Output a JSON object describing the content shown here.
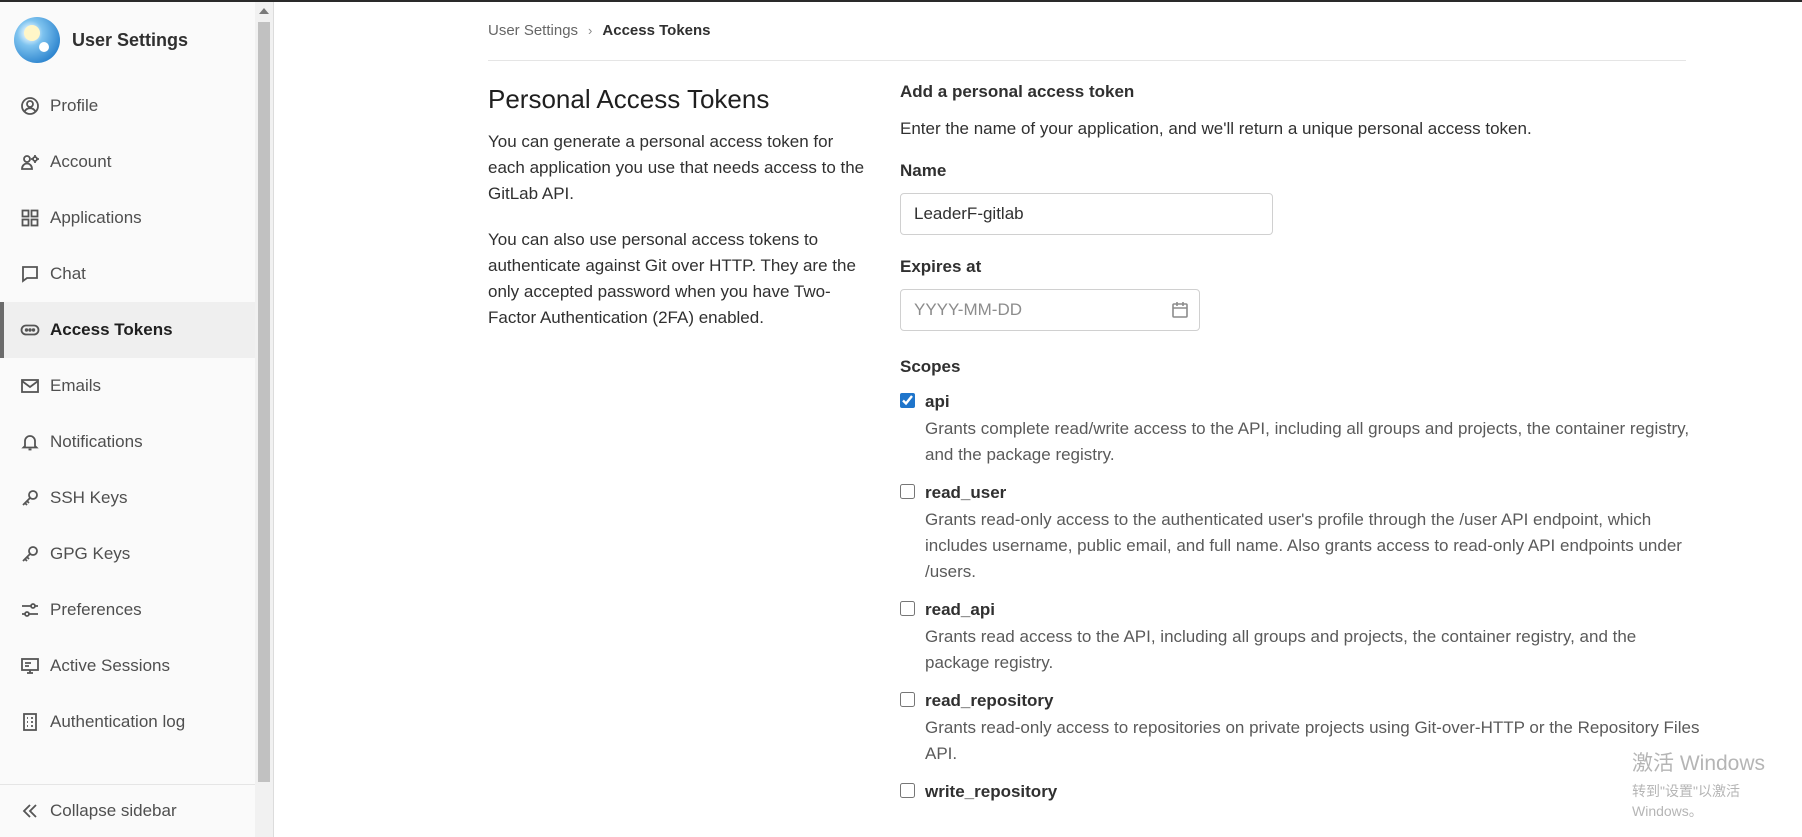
{
  "sidebar": {
    "title": "User Settings",
    "items": [
      {
        "label": "Profile",
        "icon": "profile-icon",
        "active": false
      },
      {
        "label": "Account",
        "icon": "account-icon",
        "active": false
      },
      {
        "label": "Applications",
        "icon": "applications-icon",
        "active": false
      },
      {
        "label": "Chat",
        "icon": "chat-icon",
        "active": false
      },
      {
        "label": "Access Tokens",
        "icon": "token-icon",
        "active": true
      },
      {
        "label": "Emails",
        "icon": "mail-icon",
        "active": false
      },
      {
        "label": "Notifications",
        "icon": "bell-icon",
        "active": false
      },
      {
        "label": "SSH Keys",
        "icon": "key-icon",
        "active": false
      },
      {
        "label": "GPG Keys",
        "icon": "key-icon",
        "active": false
      },
      {
        "label": "Preferences",
        "icon": "preferences-icon",
        "active": false
      },
      {
        "label": "Active Sessions",
        "icon": "monitor-icon",
        "active": false
      },
      {
        "label": "Authentication log",
        "icon": "log-icon",
        "active": false
      }
    ],
    "collapse_label": "Collapse sidebar"
  },
  "breadcrumb": {
    "root": "User Settings",
    "separator": "›",
    "current": "Access Tokens"
  },
  "intro": {
    "title": "Personal Access Tokens",
    "paragraph1": "You can generate a personal access token for each application you use that needs access to the GitLab API.",
    "paragraph2": "You can also use personal access tokens to authenticate against Git over HTTP. They are the only accepted password when you have Two-Factor Authentication (2FA) enabled."
  },
  "form": {
    "title": "Add a personal access token",
    "description": "Enter the name of your application, and we'll return a unique personal access token.",
    "name_label": "Name",
    "name_value": "LeaderF-gitlab",
    "expires_label": "Expires at",
    "expires_placeholder": "YYYY-MM-DD",
    "scopes_label": "Scopes",
    "scopes": [
      {
        "name": "api",
        "checked": true,
        "description": "Grants complete read/write access to the API, including all groups and projects, the container registry, and the package registry."
      },
      {
        "name": "read_user",
        "checked": false,
        "description": "Grants read-only access to the authenticated user's profile through the /user API endpoint, which includes username, public email, and full name. Also grants access to read-only API endpoints under /users."
      },
      {
        "name": "read_api",
        "checked": false,
        "description": "Grants read access to the API, including all groups and projects, the container registry, and the package registry."
      },
      {
        "name": "read_repository",
        "checked": false,
        "description": "Grants read-only access to repositories on private projects using Git-over-HTTP or the Repository Files API."
      },
      {
        "name": "write_repository",
        "checked": false,
        "description": ""
      }
    ]
  },
  "watermark": {
    "line1": "激活 Windows",
    "line2": "转到\"设置\"以激活 Windows。"
  },
  "colors": {
    "accent": "#1f75cb",
    "sidebar_bg": "#fafafa",
    "active_item_bg": "#efefef"
  }
}
